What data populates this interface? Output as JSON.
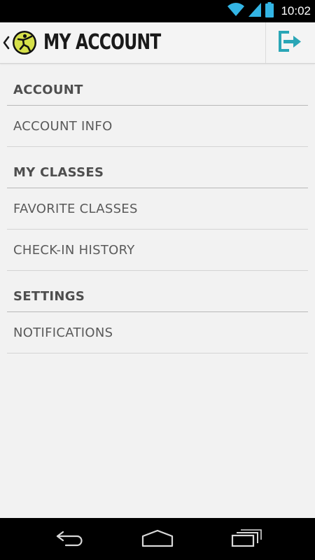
{
  "status_bar": {
    "time": "10:02",
    "icons": [
      "wifi-icon",
      "signal-icon",
      "battery-icon"
    ]
  },
  "action_bar": {
    "title": "MY ACCOUNT",
    "logo": "zumba-logo",
    "back_icon": "back-caret-icon",
    "action_icon": "logout-icon"
  },
  "sections": [
    {
      "header": "ACCOUNT",
      "items": [
        "ACCOUNT INFO"
      ]
    },
    {
      "header": "MY CLASSES",
      "items": [
        "FAVORITE CLASSES",
        "CHECK-IN HISTORY"
      ]
    },
    {
      "header": "SETTINGS",
      "items": [
        "NOTIFICATIONS"
      ]
    }
  ],
  "nav_bar": {
    "buttons": [
      "back-icon",
      "home-icon",
      "recent-apps-icon"
    ]
  },
  "colors": {
    "accent": "#2aa6b6",
    "logo_yellow": "#d6e04a",
    "background": "#f2f2f2",
    "header_text": "#4e4e4e"
  }
}
